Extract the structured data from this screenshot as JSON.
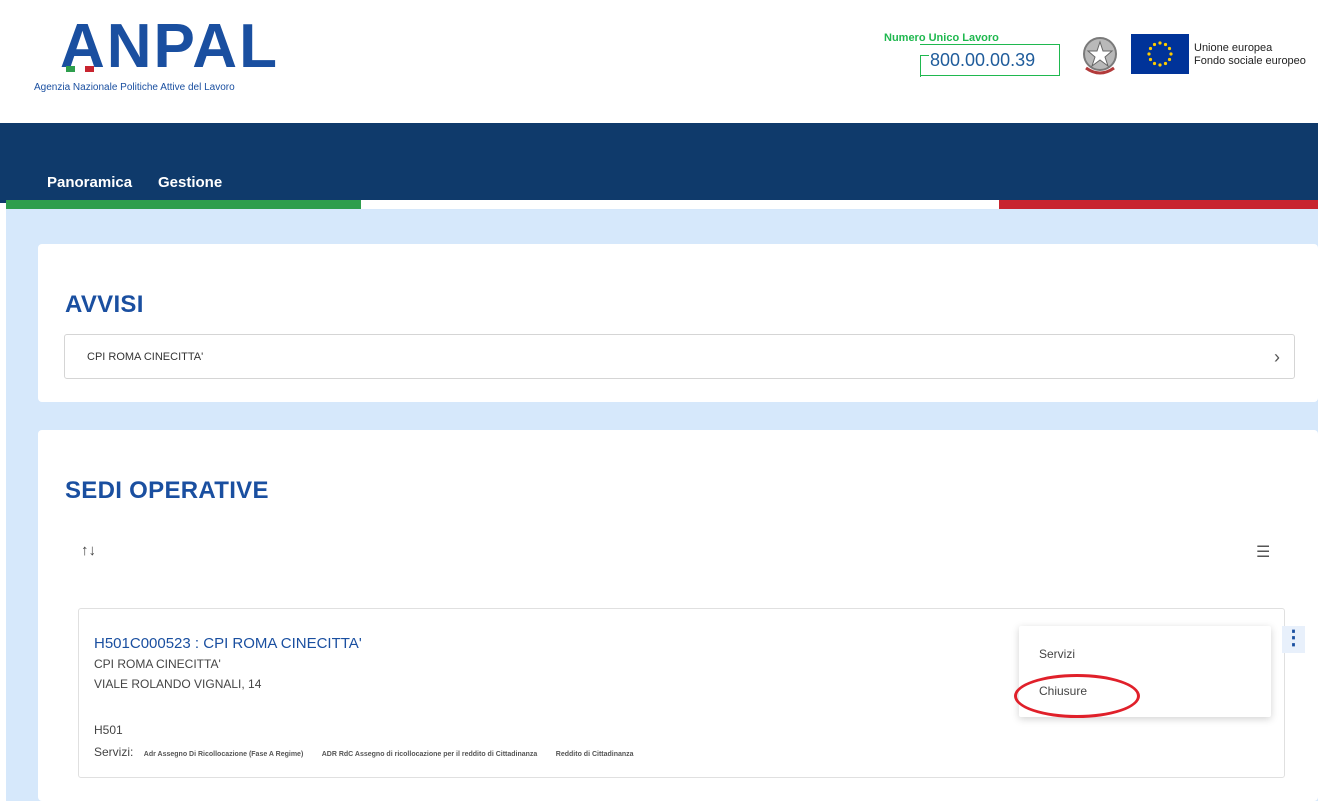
{
  "header": {
    "logo_text": "ANPAL",
    "logo_subtitle": "Agenzia Nazionale Politiche Attive del Lavoro",
    "hotline_label": "Numero Unico Lavoro",
    "hotline_number": "800.00.00.39",
    "eu_text_line1": "Unione europea",
    "eu_text_line2": "Fondo sociale europeo"
  },
  "nav": {
    "items": [
      {
        "label": "Panoramica"
      },
      {
        "label": "Gestione"
      }
    ]
  },
  "avvisi": {
    "title": "AVVISI",
    "items": [
      {
        "label": "CPI ROMA CINECITTA'"
      }
    ]
  },
  "sedi": {
    "title": "SEDI OPERATIVE",
    "card": {
      "title": "H501C000523 : CPI ROMA CINECITTA'",
      "name": "CPI ROMA CINECITTA'",
      "address": "VIALE ROLANDO VIGNALI, 14",
      "code": "H501",
      "servizi_label": "Servizi:",
      "servizi": [
        "Adr Assegno Di Ricollocazione (Fase A Regime)",
        "ADR RdC Assegno di ricollocazione per il reddito di Cittadinanza",
        "Reddito di Cittadinanza"
      ]
    },
    "menu": [
      {
        "label": "Servizi"
      },
      {
        "label": "Chiusure"
      }
    ]
  },
  "colors": {
    "brand_blue": "#1a4fa0",
    "navbar": "#0f3a6b",
    "flag_green": "#2e9e4d",
    "flag_red": "#c8242f",
    "hotline_green": "#1fb84f",
    "page_bg": "#d6e8fb",
    "annotation_red": "#e0202a"
  },
  "icons": {
    "sort": "sort-arrows-icon",
    "list": "list-view-icon",
    "chevron": "chevron-right-icon",
    "kebab": "kebab-menu-icon"
  }
}
